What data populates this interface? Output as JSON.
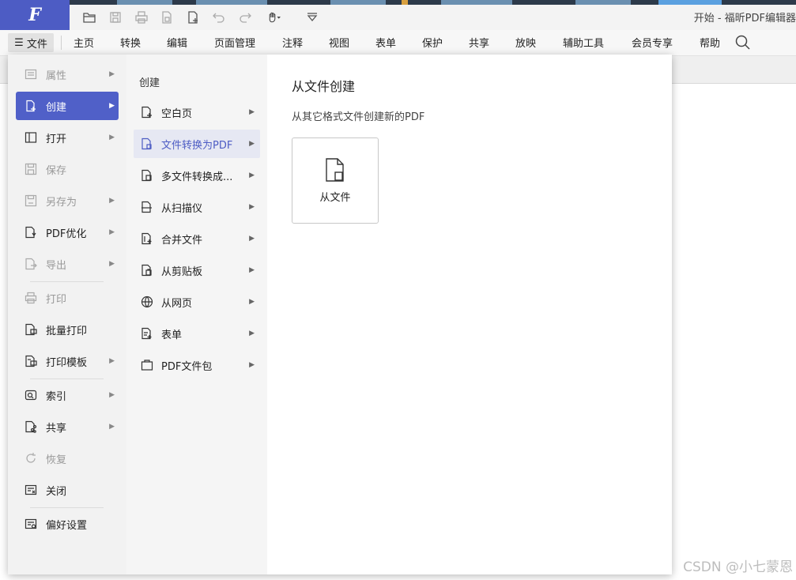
{
  "window": {
    "title": "开始 - 福昕PDF编辑器"
  },
  "logo": {
    "letter": "F"
  },
  "menubar": {
    "file_label": "文件",
    "items": [
      "主页",
      "转换",
      "编辑",
      "页面管理",
      "注释",
      "视图",
      "表单",
      "保护",
      "共享",
      "放映",
      "辅助工具",
      "会员专享",
      "帮助"
    ]
  },
  "file_menu": {
    "items": [
      {
        "label": "属性",
        "icon": "properties-icon",
        "enabled": false,
        "submenu": true
      },
      {
        "label": "创建",
        "icon": "create-icon",
        "enabled": true,
        "selected": true,
        "submenu": true
      },
      {
        "label": "打开",
        "icon": "open-icon",
        "enabled": true,
        "submenu": true
      },
      {
        "label": "保存",
        "icon": "save-icon",
        "enabled": false,
        "submenu": false
      },
      {
        "label": "另存为",
        "icon": "save-as-icon",
        "enabled": false,
        "submenu": true
      },
      {
        "label": "PDF优化",
        "icon": "pdf-optimize-icon",
        "enabled": true,
        "submenu": true
      },
      {
        "label": "导出",
        "icon": "export-icon",
        "enabled": false,
        "submenu": true
      },
      {
        "label": "打印",
        "icon": "print-icon",
        "enabled": false,
        "submenu": false
      },
      {
        "label": "批量打印",
        "icon": "batch-print-icon",
        "enabled": true,
        "submenu": false
      },
      {
        "label": "打印模板",
        "icon": "print-template-icon",
        "enabled": true,
        "submenu": true
      },
      {
        "label": "索引",
        "icon": "index-icon",
        "enabled": true,
        "submenu": true
      },
      {
        "label": "共享",
        "icon": "share-icon",
        "enabled": true,
        "submenu": true
      },
      {
        "label": "恢复",
        "icon": "restore-icon",
        "enabled": false,
        "submenu": false
      },
      {
        "label": "关闭",
        "icon": "close-doc-icon",
        "enabled": true,
        "submenu": false
      },
      {
        "label": "偏好设置",
        "icon": "preferences-icon",
        "enabled": true,
        "submenu": false
      }
    ]
  },
  "create_menu": {
    "header": "创建",
    "items": [
      {
        "label": "空白页",
        "icon": "blank-page-icon"
      },
      {
        "label": "文件转换为PDF",
        "icon": "file-to-pdf-icon",
        "selected": true
      },
      {
        "label": "多文件转换成...",
        "icon": "multi-file-convert-icon"
      },
      {
        "label": "从扫描仪",
        "icon": "scanner-icon"
      },
      {
        "label": "合并文件",
        "icon": "merge-files-icon"
      },
      {
        "label": "从剪贴板",
        "icon": "clipboard-icon"
      },
      {
        "label": "从网页",
        "icon": "web-page-icon"
      },
      {
        "label": "表单",
        "icon": "form-icon"
      },
      {
        "label": "PDF文件包",
        "icon": "pdf-portfolio-icon"
      }
    ]
  },
  "content": {
    "title": "从文件创建",
    "description": "从其它格式文件创建新的PDF",
    "card_label": "从文件"
  },
  "watermark": "CSDN @小七蒙恩",
  "colors": {
    "accent": "#4d5cc4",
    "selected_bg": "#5060c8",
    "hover_bg": "#e6e8f3"
  }
}
